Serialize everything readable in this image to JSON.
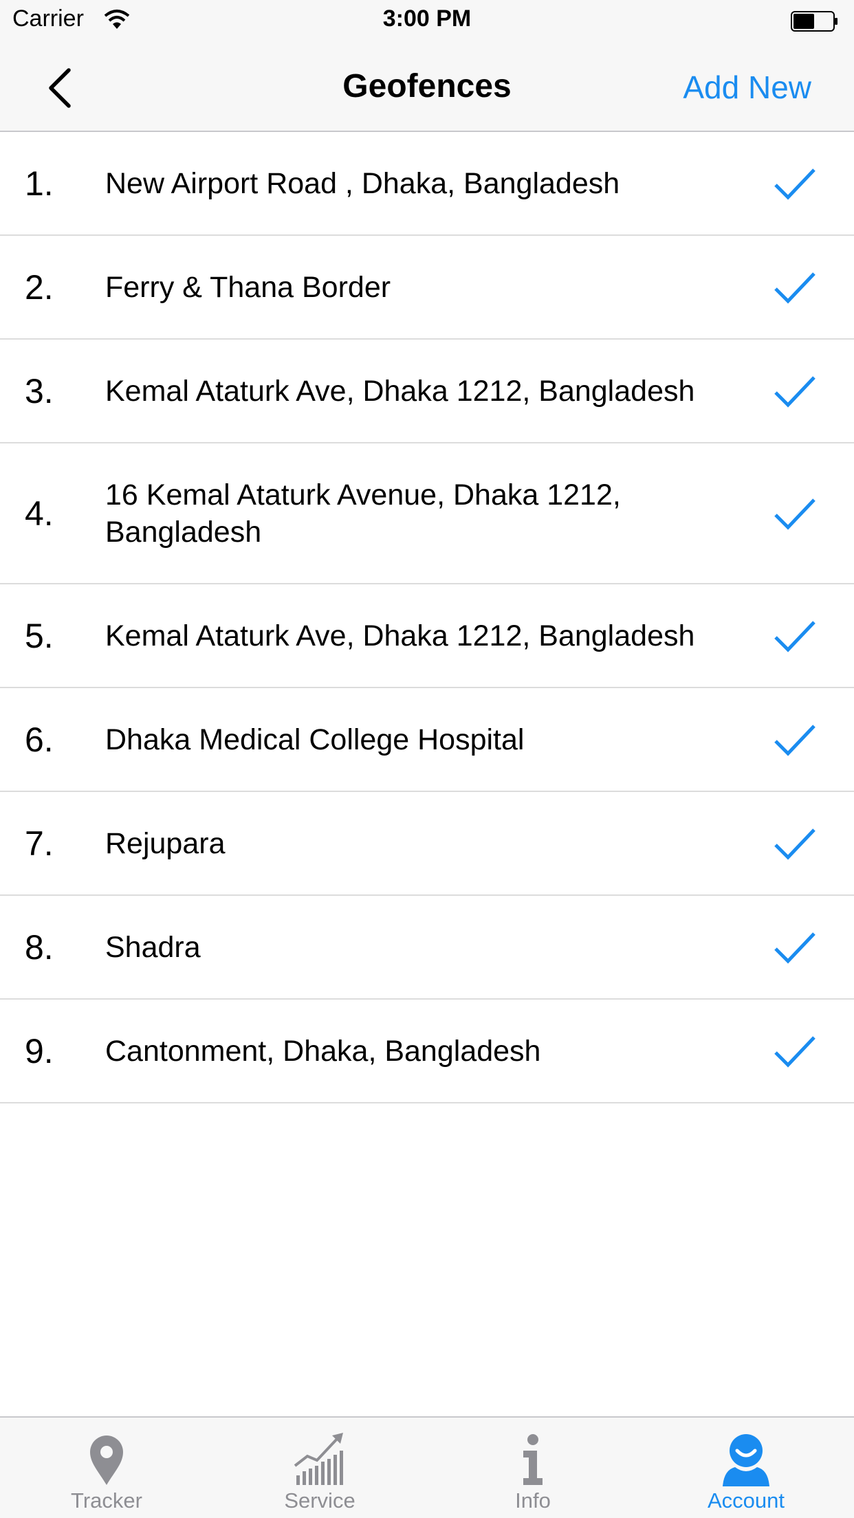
{
  "status_bar": {
    "carrier": "Carrier",
    "time": "3:00 PM"
  },
  "nav": {
    "title": "Geofences",
    "add_new": "Add New"
  },
  "geofences": [
    {
      "number": "1.",
      "name": "New Airport Road , Dhaka, Bangladesh"
    },
    {
      "number": "2.",
      "name": "Ferry & Thana Border"
    },
    {
      "number": "3.",
      "name": "Kemal Ataturk Ave, Dhaka 1212, Bangladesh"
    },
    {
      "number": "4.",
      "name": "16 Kemal Ataturk Avenue, Dhaka 1212, Bangladesh"
    },
    {
      "number": "5.",
      "name": "Kemal Ataturk Ave, Dhaka 1212, Bangladesh"
    },
    {
      "number": "6.",
      "name": "Dhaka Medical College Hospital"
    },
    {
      "number": "7.",
      "name": "Rejupara"
    },
    {
      "number": "8.",
      "name": "Shadra"
    },
    {
      "number": "9.",
      "name": "Cantonment, Dhaka, Bangladesh"
    }
  ],
  "tabs": [
    {
      "label": "Tracker",
      "icon": "location-pin-icon"
    },
    {
      "label": "Service",
      "icon": "growth-chart-icon"
    },
    {
      "label": "Info",
      "icon": "info-icon"
    },
    {
      "label": "Account",
      "icon": "user-icon"
    }
  ],
  "colors": {
    "accent": "#1a8cf0",
    "inactive_tab": "#8e8e93"
  }
}
